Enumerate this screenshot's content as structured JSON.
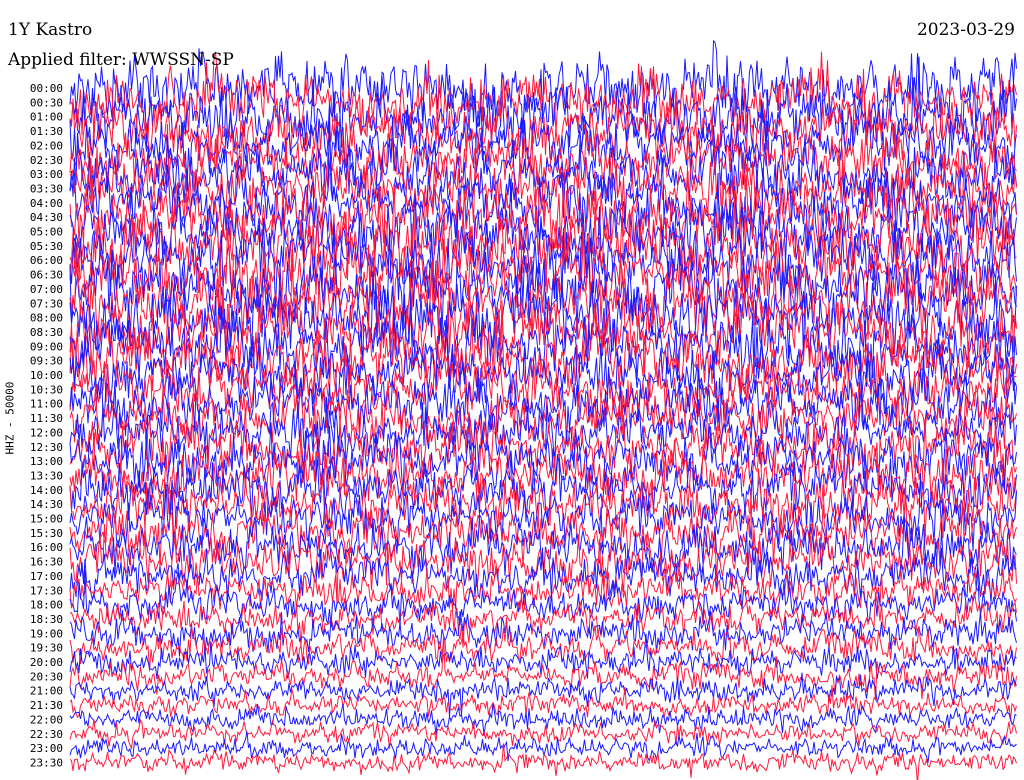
{
  "header": {
    "station": "1Y Kastro",
    "date": "2023-03-29",
    "filter": "Applied filter: WWSSN-SP"
  },
  "chart_data": {
    "type": "line",
    "title": "1Y Kastro",
    "ylabel": "HHZ - 50000",
    "row_labels": [
      "00:00",
      "00:30",
      "01:00",
      "01:30",
      "02:00",
      "02:30",
      "03:00",
      "03:30",
      "04:00",
      "04:30",
      "05:00",
      "05:30",
      "06:00",
      "06:30",
      "07:00",
      "07:30",
      "08:00",
      "08:30",
      "09:00",
      "09:30",
      "10:00",
      "10:30",
      "11:00",
      "11:30",
      "12:00",
      "12:30",
      "13:00",
      "13:30",
      "14:00",
      "14:30",
      "15:00",
      "15:30",
      "16:00",
      "16:30",
      "17:00",
      "17:30",
      "18:00",
      "18:30",
      "19:00",
      "19:30",
      "20:00",
      "20:30",
      "21:00",
      "21:30",
      "22:00",
      "22:30",
      "23:00",
      "23:30"
    ],
    "trace_colors": [
      "#1a1aff",
      "#ff1a3c"
    ],
    "colors": {
      "blue": "#0000ff",
      "red": "#ff0033"
    },
    "relative_amplitude": [
      3.2,
      3.0,
      3.0,
      2.9,
      2.7,
      2.7,
      2.8,
      2.9,
      3.0,
      3.1,
      3.2,
      3.3,
      3.3,
      3.3,
      3.3,
      3.3,
      3.3,
      3.2,
      3.1,
      3.0,
      2.8,
      2.7,
      2.6,
      2.6,
      2.6,
      2.6,
      2.6,
      2.6,
      2.5,
      2.5,
      2.4,
      2.4,
      2.4,
      2.3,
      2.0,
      1.8,
      1.7,
      1.6,
      1.6,
      1.5,
      1.4,
      1.3,
      1.2,
      1.1,
      1.1,
      1.0,
      1.0,
      1.0
    ]
  }
}
